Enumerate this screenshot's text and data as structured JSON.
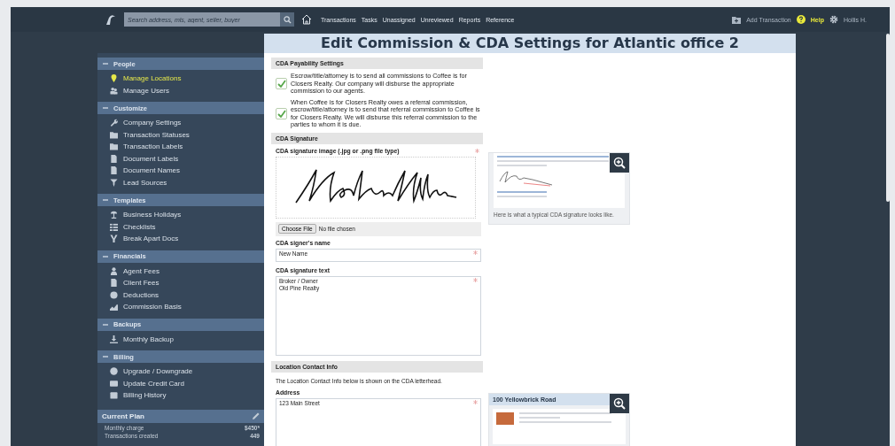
{
  "top_bar": {
    "search": {
      "placeholder": "Search address, mls, agent, seller, buyer"
    },
    "nav": [
      "Transactions",
      "Tasks",
      "Unassigned",
      "Unreviewed",
      "Reports",
      "Reference"
    ],
    "add_transaction": "Add Transaction",
    "help": "Help",
    "user": "Hollis H."
  },
  "sidebar": {
    "sections": [
      {
        "title": "People",
        "expanded": true,
        "items": [
          {
            "label": "Manage Locations",
            "selected": true
          },
          {
            "label": "Manage Users",
            "selected": false
          }
        ]
      },
      {
        "title": "Customize",
        "expanded": true,
        "items": [
          {
            "label": "Company Settings",
            "selected": false
          },
          {
            "label": "Transaction Statuses",
            "selected": false
          },
          {
            "label": "Transaction Labels",
            "selected": false
          },
          {
            "label": "Document Labels",
            "selected": false
          },
          {
            "label": "Document Names",
            "selected": false
          },
          {
            "label": "Lead Sources",
            "selected": false
          }
        ]
      },
      {
        "title": "Templates",
        "expanded": true,
        "items": [
          {
            "label": "Business Holidays",
            "selected": false
          },
          {
            "label": "Checklists",
            "selected": false
          },
          {
            "label": "Break Apart Docs",
            "selected": false
          }
        ]
      },
      {
        "title": "Financials",
        "expanded": true,
        "items": [
          {
            "label": "Agent Fees",
            "selected": false
          },
          {
            "label": "Client Fees",
            "selected": false
          },
          {
            "label": "Deductions",
            "selected": false
          },
          {
            "label": "Commission Basis",
            "selected": false
          }
        ]
      },
      {
        "title": "Backups",
        "expanded": true,
        "items": [
          {
            "label": "Monthly Backup",
            "selected": false
          }
        ]
      },
      {
        "title": "Billing",
        "expanded": true,
        "items": [
          {
            "label": "Upgrade / Downgrade",
            "selected": false
          },
          {
            "label": "Update Credit Card",
            "selected": false
          },
          {
            "label": "Billing History",
            "selected": false
          }
        ]
      }
    ],
    "current_plan": {
      "title": "Current Plan",
      "rows": [
        {
          "label": "Monthly charge",
          "value": "$450*"
        },
        {
          "label": "Transactions created",
          "value": "449"
        }
      ]
    }
  },
  "page": {
    "title": "Edit Commission & CDA Settings for Atlantic office 2",
    "payability": {
      "title": "CDA Payability Settings",
      "options": [
        {
          "text": "Escrow/title/attorney is to send all commissions to Coffee is for Closers Realty. Our company will disburse the appropriate commission to our agents.",
          "checked": true
        },
        {
          "text": "When Coffee is for Closers Realty owes a referral commission, escrow/title/attorney is to send that referral commission to Coffee is for Closers Realty. We will disburse this referral commission to the parties to whom it is due.",
          "checked": true
        }
      ]
    },
    "signature": {
      "title": "CDA Signature",
      "image_label": "CDA signature image (.jpg or .png file type)",
      "image_required": true,
      "file_button": "Choose File",
      "file_status": "No file chosen",
      "name_label": "CDA signer's name",
      "name_value": "New Name",
      "name_required": true,
      "text_label": "CDA signature text",
      "text_value": "Broker / Owner\nOld Pine Realty",
      "text_required": true,
      "example_caption": "Here is what a typical CDA signature looks like."
    },
    "contact": {
      "title": "Location Contact Info",
      "note": "The Location Contact Info below is shown on the CDA letterhead.",
      "address_label": "Address",
      "address_value": "123 Main Street",
      "address_required": true,
      "example_heading": "100 Yellowbrick Road"
    }
  }
}
